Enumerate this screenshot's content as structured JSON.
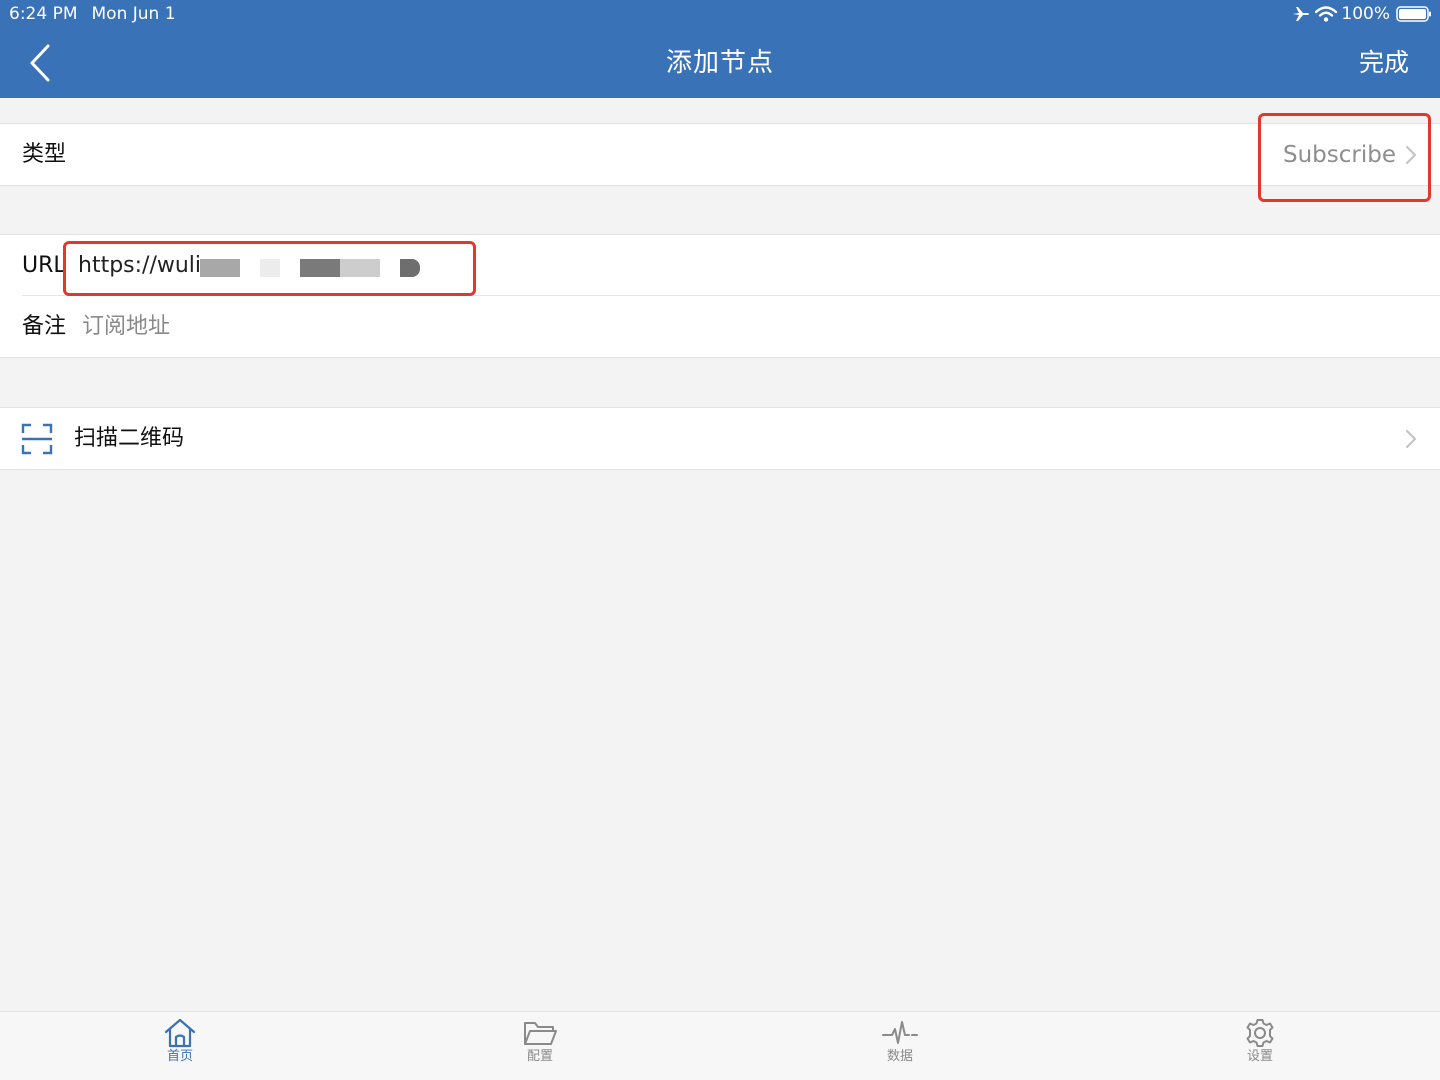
{
  "status_bar": {
    "time": "6:24 PM",
    "date": "Mon Jun 1",
    "battery": "100%"
  },
  "nav": {
    "title": "添加节点",
    "done_label": "完成"
  },
  "form": {
    "type_label": "类型",
    "type_value": "Subscribe",
    "url_label": "URL",
    "url_value": "https://wuliv",
    "note_label": "备注",
    "note_placeholder": "订阅地址"
  },
  "scan": {
    "label": "扫描二维码"
  },
  "tabs": [
    {
      "label": "首页",
      "icon": "home-icon",
      "active": true
    },
    {
      "label": "配置",
      "icon": "folder-icon",
      "active": false
    },
    {
      "label": "数据",
      "icon": "activity-icon",
      "active": false
    },
    {
      "label": "设置",
      "icon": "gear-icon",
      "active": false
    }
  ],
  "colors": {
    "accent": "#3a72b8",
    "highlight": "#e0392b",
    "background": "#f3f3f3"
  }
}
